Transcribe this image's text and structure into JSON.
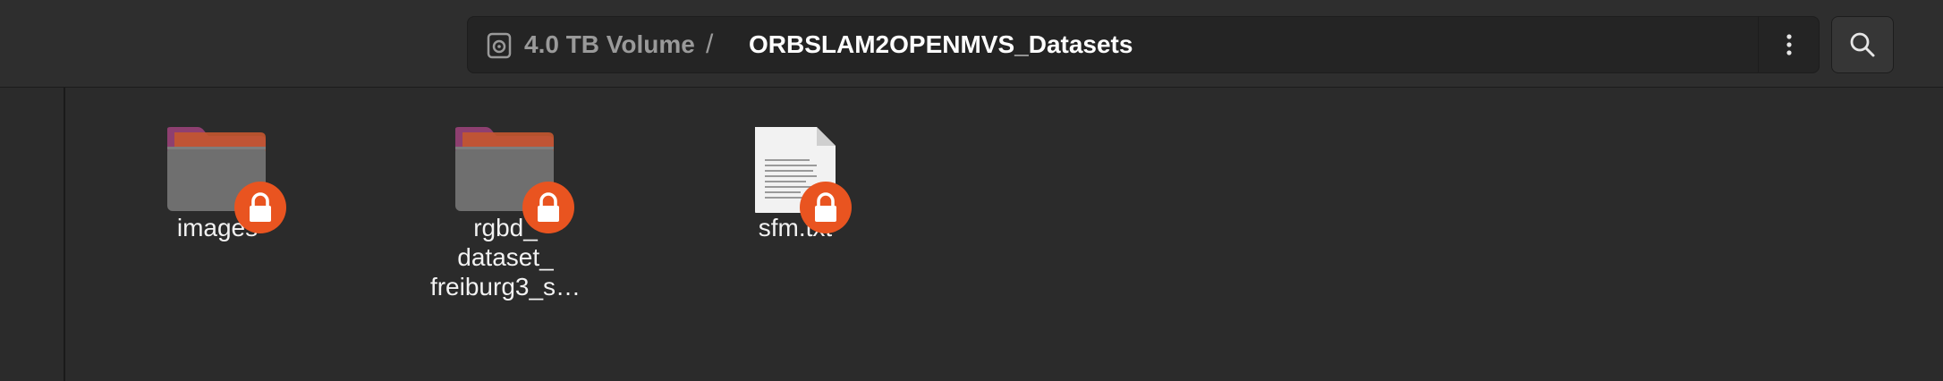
{
  "header": {
    "breadcrumb": {
      "volume_label": "4.0 TB Volume",
      "separator": "/",
      "current_folder": "ORBSLAM2OPENMVS_Datasets"
    },
    "menu_icon": "vertical-ellipsis-icon",
    "search_icon": "search-icon"
  },
  "files": [
    {
      "type": "folder",
      "name_lines": [
        "images"
      ],
      "locked": true
    },
    {
      "type": "folder",
      "name_lines": [
        "rgbd_",
        "dataset_",
        "freiburg3_s…"
      ],
      "locked": true
    },
    {
      "type": "text-file",
      "name_lines": [
        "sfm.txt"
      ],
      "locked": true
    }
  ],
  "colors": {
    "accent": "#e95420",
    "folder_top": "#9b3a6e",
    "folder_body": "#6f6f6f",
    "background": "#2b2b2b"
  }
}
